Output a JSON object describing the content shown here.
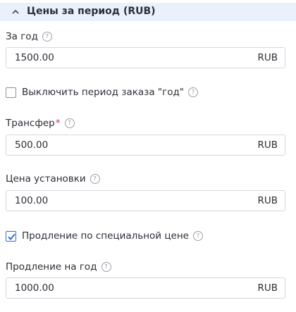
{
  "section": {
    "title": "Цены за период (RUB)"
  },
  "year_price": {
    "label": "За год",
    "value": "1500.00",
    "unit": "RUB"
  },
  "disable_year": {
    "label": "Выключить период заказа \"год\"",
    "checked": false
  },
  "transfer": {
    "label": "Трансфер",
    "required_mark": "*",
    "value": "500.00",
    "unit": "RUB"
  },
  "setup_price": {
    "label": "Цена установки",
    "value": "100.00",
    "unit": "RUB"
  },
  "special_renewal": {
    "label": "Продление по специальной цене",
    "checked": true
  },
  "renewal_year": {
    "label": "Продление на год",
    "value": "1000.00",
    "unit": "RUB"
  },
  "help_glyph": "?",
  "colors": {
    "accent": "#2d6fd6",
    "header_bg": "#eaf1fc",
    "required": "#d6334a"
  }
}
